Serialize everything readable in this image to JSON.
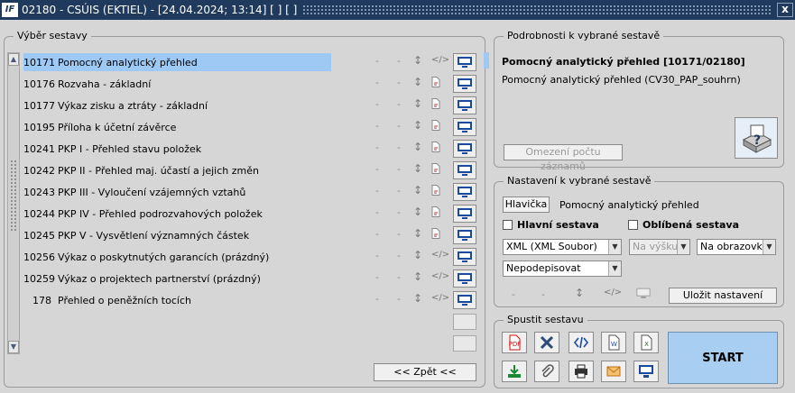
{
  "window": {
    "title": "02180 - CSÚIS (EKTIEL) - [24.04.2024; 13:14]  [ ]  [ ]",
    "logo_text": "IF",
    "close_label": "x"
  },
  "left_group": {
    "title": "Výběr sestavy"
  },
  "reports": [
    {
      "code": "10171",
      "name": "Pomocný analytický přehled",
      "selected": true,
      "icon": "code-icon"
    },
    {
      "code": "10176",
      "name": "Rozvaha - základní",
      "icon": "pdf-icon"
    },
    {
      "code": "10177",
      "name": "Výkaz zisku a ztráty - základní",
      "icon": "pdf-icon"
    },
    {
      "code": "10195",
      "name": "Příloha k účetní závěrce",
      "icon": "pdf-icon"
    },
    {
      "code": "10241",
      "name": "PKP I - Přehled stavu položek",
      "icon": "pdf-icon"
    },
    {
      "code": "10242",
      "name": "PKP II - Přehled maj. účastí a jejich změn",
      "icon": "pdf-icon"
    },
    {
      "code": "10243",
      "name": "PKP III - Vyloučení vzájemných vztahů",
      "icon": "pdf-icon"
    },
    {
      "code": "10244",
      "name": "PKP IV - Přehled podrozvahových položek",
      "icon": "pdf-icon"
    },
    {
      "code": "10245",
      "name": "PKP V - Vysvětlení významných částek",
      "icon": "pdf-icon"
    },
    {
      "code": "10256",
      "name": "Výkaz o poskytnutých garancích (prázdný)",
      "icon": "code-icon"
    },
    {
      "code": "10259",
      "name": "Výkaz o projektech partnerství (prázdný)",
      "icon": "code-icon"
    },
    {
      "code": "178",
      "name": "Přehled o peněžních tocích",
      "icon": "code-icon"
    }
  ],
  "back_button": "<< Zpět <<",
  "details": {
    "group_title": "Podrobnosti k vybrané sestavě",
    "title": "Pomocný analytický přehled [10171/02180]",
    "subtitle": "Pomocný analytický přehled (CV30_PAP_souhrn)",
    "limit_button": "Omezení počtu záznamů"
  },
  "settings": {
    "group_title": "Nastavení k vybrané sestavě",
    "header_button": "Hlavička",
    "header_value": "Pomocný analytický přehled",
    "main_report_label": "Hlavní sestava",
    "favorite_label": "Oblíbená sestava",
    "format_select": "XML (XML Soubor)",
    "orientation_select": "Na výšku",
    "output_select": "Na obrazovku",
    "signing_select": "Nepodepisovat",
    "save_button": "Uložit nastavení"
  },
  "run": {
    "group_title": "Spustit sestavu",
    "start_label": "START"
  },
  "colors": {
    "titlebar": "#1f3a5c",
    "selection": "#9ec9f5",
    "start": "#a8cff2"
  }
}
